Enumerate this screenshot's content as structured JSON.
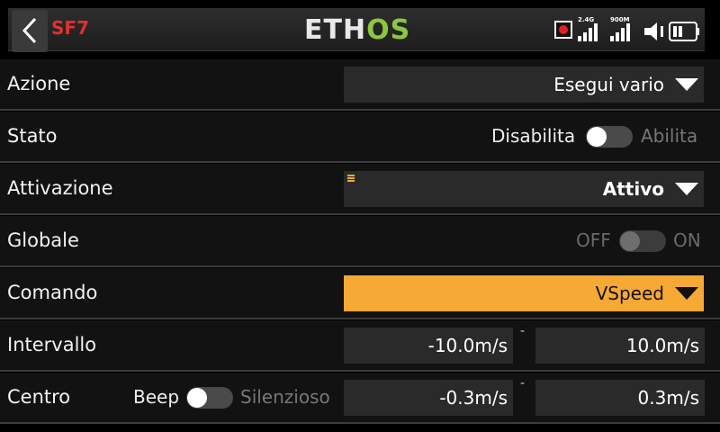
{
  "header": {
    "title": "SF7",
    "logo_part1": "ETH",
    "logo_part2": "OS",
    "band_24": "2.4G",
    "band_900": "900M"
  },
  "rows": {
    "azione": {
      "label": "Azione",
      "value": "Esegui vario"
    },
    "stato": {
      "label": "Stato",
      "off_text": "Disabilita",
      "on_text": "Abilita"
    },
    "attivazione": {
      "label": "Attivazione",
      "value": "Attivo"
    },
    "globale": {
      "label": "Globale",
      "off_text": "OFF",
      "on_text": "ON"
    },
    "comando": {
      "label": "Comando",
      "value": "VSpeed"
    },
    "intervallo": {
      "label": "Intervallo",
      "min": "-10.0m/s",
      "max": "10.0m/s",
      "separator": "-"
    },
    "centro": {
      "label": "Centro",
      "off_text": "Beep",
      "on_text": "Silenzioso",
      "min": "-0.3m/s",
      "max": "0.3m/s",
      "separator": "-"
    }
  },
  "colors": {
    "accent": "#f7a935",
    "title_red": "#e03030",
    "logo_green": "#8dc63f"
  }
}
